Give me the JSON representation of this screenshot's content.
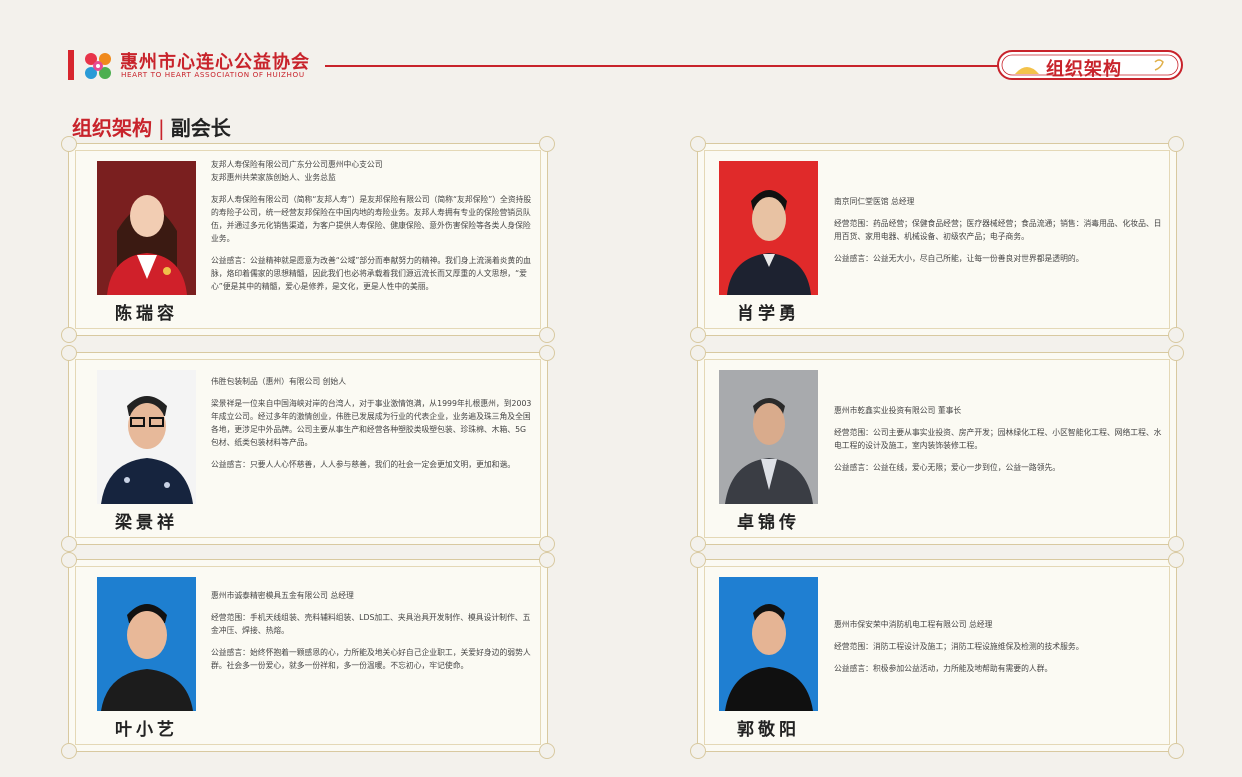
{
  "header": {
    "org_name_cn": "惠州市心连心公益协会",
    "org_name_en": "HEART TO HEART ASSOCIATION OF HUIZHOU",
    "section_badge": "组织架构"
  },
  "page_title": {
    "main": "组织架构",
    "separator": "|",
    "sub": "副会长"
  },
  "colors": {
    "brand_red": "#c8232b",
    "card_border": "#d8c9a0",
    "page_bg": "#f3f1ec"
  },
  "members": [
    {
      "name": "陈瑞容",
      "company": "友邦人寿保险有限公司广东分公司惠州中心支公司",
      "role": "友邦惠州共荣家族创始人、业务总监",
      "body": "友邦人寿保险有限公司（简称“友邦人寿”）是友邦保险有限公司（简称“友邦保险”）全资持股的寿险子公司，统一经营友邦保险在中国内地的寿险业务。友邦人寿拥有专业的保险营销员队伍，并通过多元化销售渠道，为客户提供人寿保险、健康保险、意外伤害保险等各类人身保险业务。",
      "motto": "公益感言：公益精神就是愿意为改善“公域”部分而奉献努力的精神。我们身上流淌着炎黄的血脉，烙印着儒家的思想精髓，因此我们也必将承载着我们源远流长而又厚重的人文思想，“爱心”便是其中的精髓，爱心是修养，是文化，更是人性中的美丽。"
    },
    {
      "name": "肖学勇",
      "company": "南京同仁堂医馆   总经理",
      "body": "经营范围：药品经营；保健食品经营；医疗器械经营；食品流通；销售：消毒用品、化妆品、日用百货、家用电器、机械设备、初级农产品；电子商务。",
      "motto": "公益感言：公益无大小，尽自己所能，让每一份善良对世界都是透明的。"
    },
    {
      "name": "梁景祥",
      "company": "伟胜包装制品（惠州）有限公司   创始人",
      "body": "梁景祥是一位来自中国海峡对岸的台湾人，对于事业激情饱满，从1999年扎根惠州，到2003年成立公司。经过多年的激情创业，伟胜已发展成为行业的代表企业，业务遍及珠三角及全国各地，更涉足中外品牌。公司主要从事生产和经营各种塑胶类吸塑包装、珍珠棉、木箱、5G包材、纸类包装材料等产品。",
      "motto": "公益感言：只要人人心怀慈善，人人参与慈善，我们的社会一定会更加文明，更加和谐。"
    },
    {
      "name": "卓锦传",
      "company": "惠州市乾鑫实业投资有限公司   董事长",
      "body": "经营范围：公司主要从事实业投资、房产开发；园林绿化工程、小区智能化工程、网络工程、水电工程的设计及施工，室内装饰装修工程。",
      "motto": "公益感言：公益在线，爱心无限；爱心一步到位，公益一路领先。"
    },
    {
      "name": "叶小艺",
      "company": "惠州市诚泰精密模具五金有限公司   总经理",
      "body": "经营范围：手机天线组装、壳料辅料组装、LDS加工、夹具治具开发制作、模具设计制作、五金冲压、焊接、热熔。",
      "motto": "公益感言：始终怀抱着一颗感恩的心，力所能及地关心好自己企业职工，关爱好身边的弱势人群。社会多一份爱心，就多一份祥和，多一份温暖。不忘初心，牢记使命。"
    },
    {
      "name": "郭敬阳",
      "company": "惠州市保安荣中消防机电工程有限公司   总经理",
      "body": "经营范围：消防工程设计及施工；消防工程设施维保及检测的技术服务。",
      "motto": "公益感言：积极参加公益活动，力所能及地帮助有需要的人群。"
    }
  ]
}
